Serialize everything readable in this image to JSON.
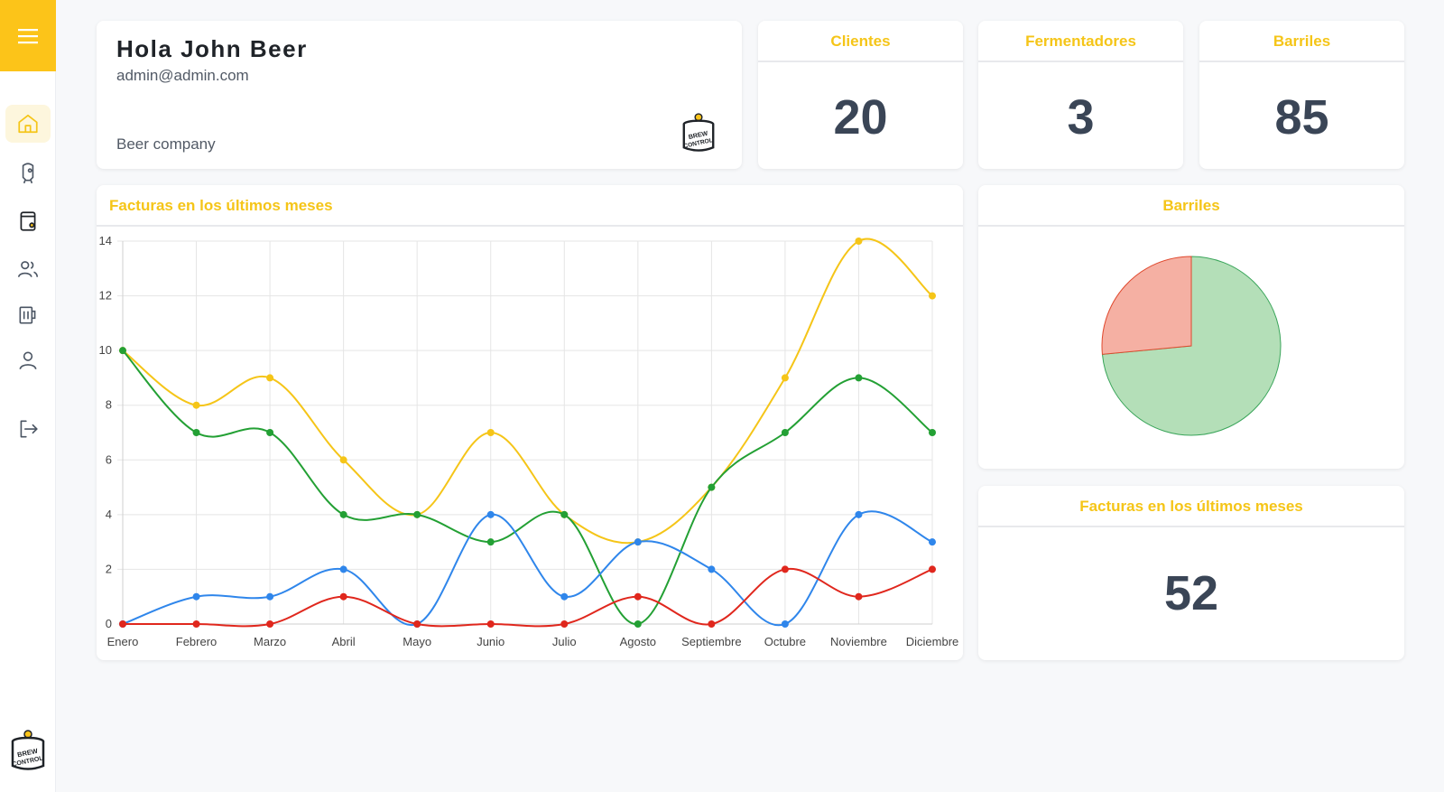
{
  "sidebar": {
    "menu_icon": "hamburger-icon",
    "items": [
      {
        "icon": "home-icon",
        "active": true
      },
      {
        "icon": "fermenter-icon",
        "active": false
      },
      {
        "icon": "barrel-icon",
        "active": false
      },
      {
        "icon": "users-icon",
        "active": false
      },
      {
        "icon": "beer-mug-icon",
        "active": false
      },
      {
        "icon": "user-icon",
        "active": false
      },
      {
        "icon": "logout-icon",
        "active": false
      }
    ],
    "logo_text": "BREW CONTROL"
  },
  "welcome": {
    "greeting": "Hola John Beer",
    "email": "admin@admin.com",
    "company": "Beer company",
    "logo_text": "BREW CONTROL"
  },
  "stats": [
    {
      "title": "Clientes",
      "value": "20"
    },
    {
      "title": "Fermentadores",
      "value": "3"
    },
    {
      "title": "Barriles",
      "value": "85"
    }
  ],
  "line_card": {
    "title": "Facturas en los últimos meses"
  },
  "pie_card": {
    "title": "Barriles"
  },
  "invoices_card": {
    "title": "Facturas en los últimos meses",
    "value": "52"
  },
  "colors": {
    "accent": "#fcc419",
    "yellow": "#f5c518",
    "green": "#23a034",
    "blue": "#2f86eb",
    "red": "#e0271d",
    "pie_green_fill": "#b4dfb8",
    "pie_green_stroke": "#3aa55a",
    "pie_red_fill": "#f5b0a3",
    "pie_red_stroke": "#e0492e"
  },
  "chart_data": [
    {
      "type": "line",
      "categories": [
        "Enero",
        "Febrero",
        "Marzo",
        "Abril",
        "Mayo",
        "Junio",
        "Julio",
        "Agosto",
        "Septiembre",
        "Octubre",
        "Noviembre",
        "Diciembre"
      ],
      "series": [
        {
          "color": "#f5c518",
          "values": [
            10,
            8,
            9,
            6,
            4,
            7,
            4,
            3,
            5,
            9,
            14,
            12
          ]
        },
        {
          "color": "#23a034",
          "values": [
            10,
            7,
            7,
            4,
            4,
            3,
            4,
            0,
            5,
            7,
            9,
            7
          ]
        },
        {
          "color": "#2f86eb",
          "values": [
            0,
            1,
            1,
            2,
            0,
            4,
            1,
            3,
            2,
            0,
            4,
            3
          ]
        },
        {
          "color": "#e0271d",
          "values": [
            0,
            0,
            0,
            1,
            0,
            0,
            0,
            1,
            0,
            2,
            1,
            2
          ]
        }
      ],
      "yticks": [
        "0",
        "2",
        "4",
        "6",
        "8",
        "10",
        "12",
        "14"
      ],
      "ylim": [
        0,
        14
      ],
      "grid": true,
      "smooth": true
    },
    {
      "type": "pie",
      "slices": [
        {
          "color": "#b4dfb8",
          "value": 0.735
        },
        {
          "color": "#f5b0a3",
          "value": 0.265
        }
      ]
    }
  ]
}
